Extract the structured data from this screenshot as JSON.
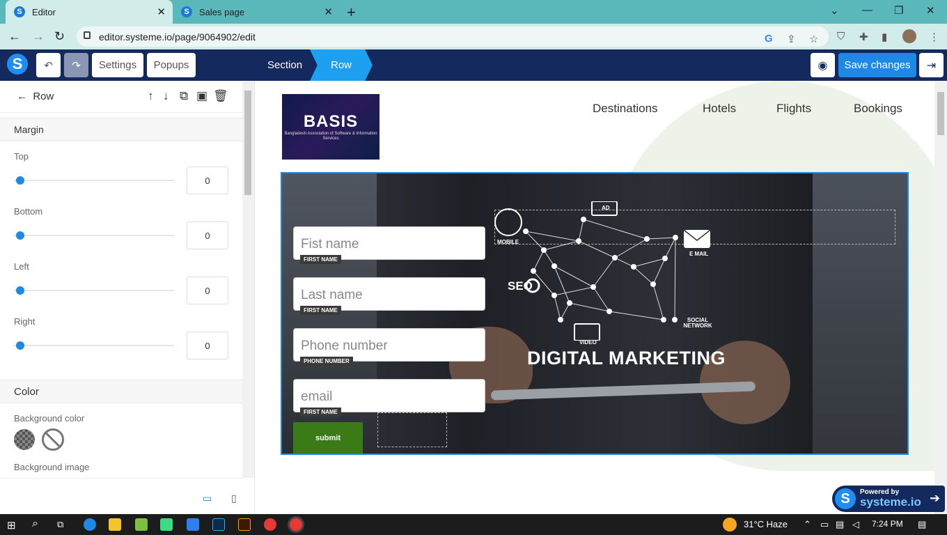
{
  "browser": {
    "tabs": [
      {
        "title": "Editor",
        "icon": "systeme-icon"
      },
      {
        "title": "Sales page",
        "icon": "systeme-icon"
      }
    ],
    "url": "editor.systeme.io/page/9064902/edit"
  },
  "editor": {
    "settings_label": "Settings",
    "popups_label": "Popups",
    "breadcrumb": [
      "Section",
      "Row"
    ],
    "save_label": "Save changes"
  },
  "sidebar": {
    "back_label": "Row",
    "margin_title": "Margin",
    "margin_fields": [
      {
        "label": "Top",
        "value": "0"
      },
      {
        "label": "Bottom",
        "value": "0"
      },
      {
        "label": "Left",
        "value": "0"
      },
      {
        "label": "Right",
        "value": "0"
      }
    ],
    "color_title": "Color",
    "bg_color_label": "Background color",
    "bg_image_label": "Background image"
  },
  "page": {
    "logo": {
      "text": "BASIS",
      "subtitle": "Bangladesh Association of Software & Information Services"
    },
    "nav": [
      "Destinations",
      "Hotels",
      "Flights",
      "Bookings"
    ],
    "form": {
      "fields": [
        {
          "placeholder": "Fist name",
          "tag": "FIRST NAME"
        },
        {
          "placeholder": "Last name",
          "tag": "FIRST NAME"
        },
        {
          "placeholder": "Phone number",
          "tag": "PHONE NUMBER"
        },
        {
          "placeholder": "email",
          "tag": "FIRST NAME"
        }
      ],
      "submit_label": "submit"
    },
    "hero": {
      "headline": "DIGITAL MARKETING",
      "icons": [
        "MOBILE",
        "AD",
        "E MAIL",
        "SEO",
        "SOCIAL NETWORK",
        "VIDEO"
      ]
    }
  },
  "powered_by": {
    "line1": "Powered by",
    "line2": "systeme.io"
  },
  "taskbar": {
    "weather": "31°C  Haze",
    "time": "7:24 PM"
  },
  "colors": {
    "toolbar": "#14295e",
    "accent": "#1e88e5",
    "submit": "#3a7b18",
    "browser": "#5ab8bb"
  }
}
